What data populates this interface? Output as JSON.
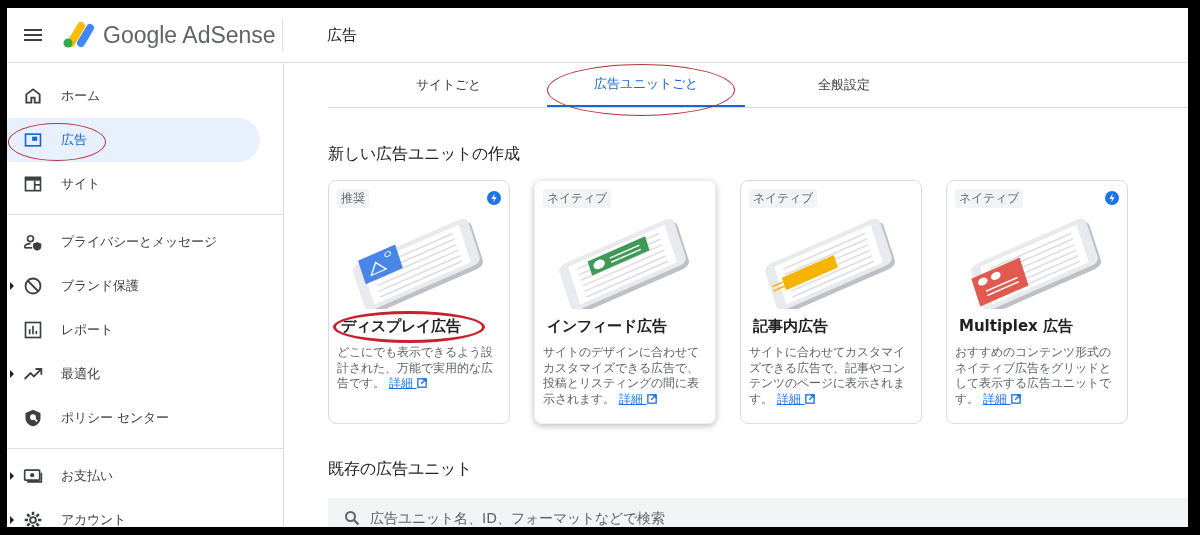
{
  "app": {
    "brand": "Google AdSense"
  },
  "header": {
    "title": "広告"
  },
  "sidebar": {
    "sections": [
      {
        "items": [
          {
            "label": "ホーム",
            "selected": false,
            "expandable": false,
            "circled": false
          },
          {
            "label": "広告",
            "selected": true,
            "expandable": false,
            "circled": true
          },
          {
            "label": "サイト",
            "selected": false,
            "expandable": false,
            "circled": false
          }
        ]
      },
      {
        "items": [
          {
            "label": "プライバシーとメッセージ",
            "selected": false,
            "expandable": false,
            "circled": false
          },
          {
            "label": "ブランド保護",
            "selected": false,
            "expandable": true,
            "circled": false
          },
          {
            "label": "レポート",
            "selected": false,
            "expandable": false,
            "circled": false
          },
          {
            "label": "最適化",
            "selected": false,
            "expandable": true,
            "circled": false
          },
          {
            "label": "ポリシー センター",
            "selected": false,
            "expandable": false,
            "circled": false
          }
        ]
      },
      {
        "items": [
          {
            "label": "お支払い",
            "selected": false,
            "expandable": true,
            "circled": false
          },
          {
            "label": "アカウント",
            "selected": false,
            "expandable": true,
            "circled": false
          }
        ]
      }
    ]
  },
  "tabs": [
    {
      "label": "サイトごと",
      "selected": false,
      "circled": false
    },
    {
      "label": "広告ユニットごと",
      "selected": true,
      "circled": true
    },
    {
      "label": "全般設定",
      "selected": false,
      "circled": false
    }
  ],
  "new_units": {
    "title": "新しい広告ユニットの作成",
    "cards": [
      {
        "kind": "display",
        "badge": "推奨",
        "bolt": true,
        "hovered": false,
        "title": "ディスプレイ広告",
        "title_circled": true,
        "description": "どこにでも表示できるよう設計された、万能で実用的な広告です。",
        "link": "詳細"
      },
      {
        "kind": "infeed",
        "badge": "ネイティブ",
        "bolt": false,
        "hovered": true,
        "title": "インフィード広告",
        "title_circled": false,
        "description": "サイトのデザインに合わせてカスタマイズできる広告で、投稿とリスティングの間に表示されます。",
        "link": "詳細"
      },
      {
        "kind": "inarticle",
        "badge": "ネイティブ",
        "bolt": false,
        "hovered": false,
        "title": "記事内広告",
        "title_circled": false,
        "description": "サイトに合わせてカスタマイズできる広告で、記事やコンテンツのページに表示されます。",
        "link": "詳細"
      },
      {
        "kind": "multiplex",
        "badge": "ネイティブ",
        "bolt": true,
        "hovered": false,
        "title": "Multiplex 広告",
        "title_circled": false,
        "description": "おすすめのコンテンツ形式のネイティブ広告をグリッドとして表示する広告ユニットです。",
        "link": "詳細"
      }
    ]
  },
  "existing_units": {
    "title": "既存の広告ユニット",
    "search": {
      "placeholder": "広告ユニット名、ID、フォーマットなどで検索"
    }
  }
}
